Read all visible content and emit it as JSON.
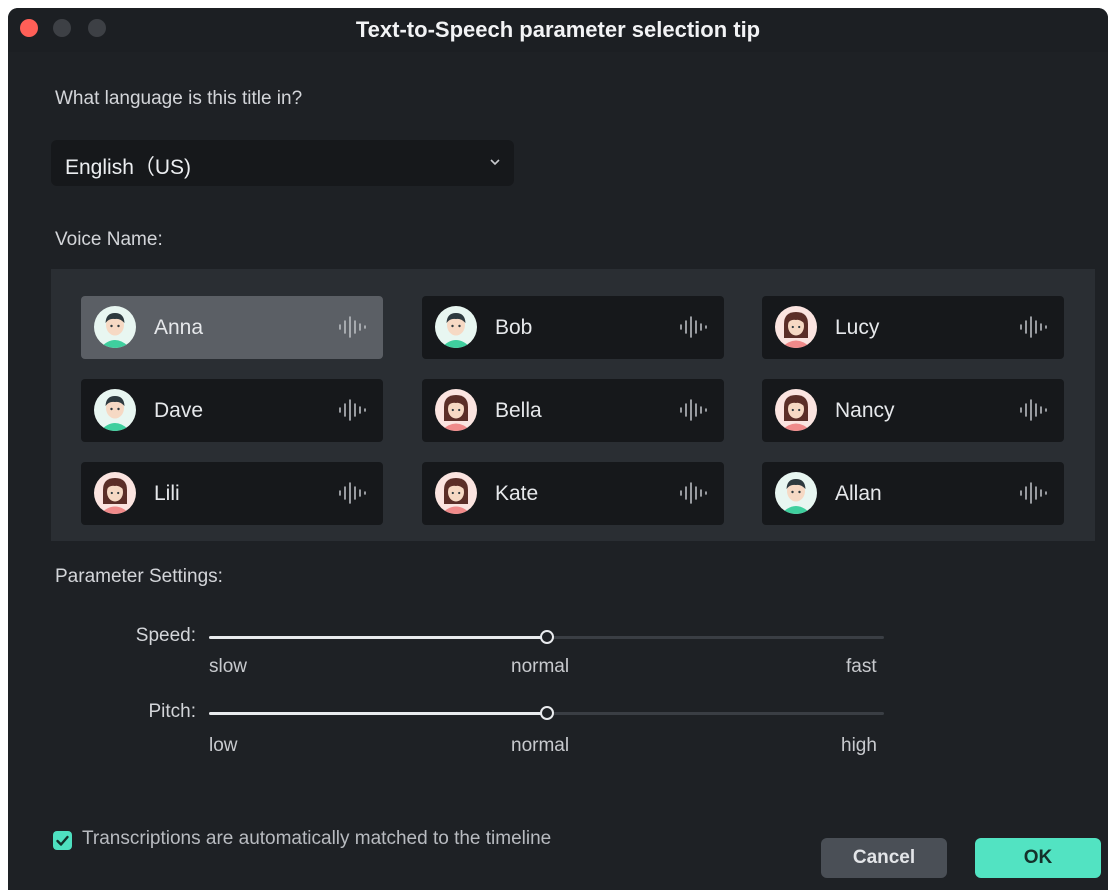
{
  "window": {
    "title": "Text-to-Speech parameter selection tip"
  },
  "language": {
    "question": "What language is this title in?",
    "selected": "English（US)"
  },
  "voice": {
    "label": "Voice Name:",
    "items": [
      {
        "name": "Anna",
        "gender": "male",
        "selected": true
      },
      {
        "name": "Bob",
        "gender": "male",
        "selected": false
      },
      {
        "name": "Lucy",
        "gender": "female",
        "selected": false
      },
      {
        "name": "Dave",
        "gender": "male",
        "selected": false
      },
      {
        "name": "Bella",
        "gender": "female",
        "selected": false
      },
      {
        "name": "Nancy",
        "gender": "female",
        "selected": false
      },
      {
        "name": "Lili",
        "gender": "female",
        "selected": false
      },
      {
        "name": "Kate",
        "gender": "female",
        "selected": false
      },
      {
        "name": "Allan",
        "gender": "male",
        "selected": false
      }
    ]
  },
  "parameters": {
    "label": "Parameter Settings:",
    "speed": {
      "label": "Speed:",
      "min": "slow",
      "mid": "normal",
      "max": "fast",
      "value": 0.5
    },
    "pitch": {
      "label": "Pitch:",
      "min": "low",
      "mid": "normal",
      "max": "high",
      "value": 0.5
    }
  },
  "footer": {
    "checkbox_label": "Transcriptions are automatically matched to the timeline",
    "checked": true,
    "cancel_label": "Cancel",
    "ok_label": "OK"
  },
  "colors": {
    "accent": "#52e3c2",
    "male_avatar": "#3fcf9e",
    "female_avatar": "#f08a8a"
  }
}
